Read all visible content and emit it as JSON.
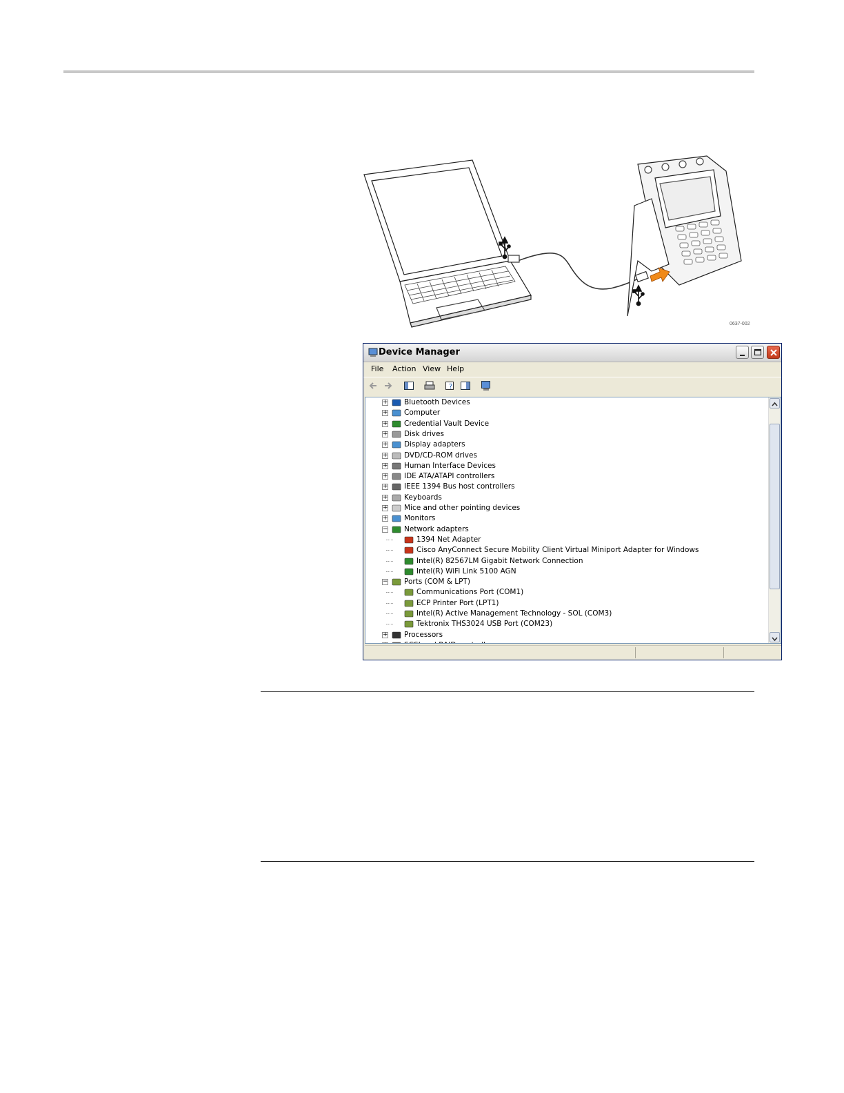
{
  "figure": {
    "id_label": "0637-002",
    "icons": [
      "laptop",
      "usb-icon",
      "usb-cable",
      "oscilloscope",
      "usb-icon"
    ]
  },
  "window": {
    "title": "Device Manager",
    "menu": [
      "File",
      "Action",
      "View",
      "Help"
    ],
    "toolbar_icons": [
      "back-arrow-icon",
      "forward-arrow-icon",
      "show-hide-console-tree-icon",
      "print-icon",
      "help-icon",
      "action-pane-icon",
      "scan-hardware-icon"
    ],
    "tree": [
      {
        "label": "Bluetooth Devices",
        "level": 0,
        "expanded": false,
        "icon": "bluetooth-icon"
      },
      {
        "label": "Computer",
        "level": 0,
        "expanded": false,
        "icon": "computer-icon"
      },
      {
        "label": "Credential Vault Device",
        "level": 0,
        "expanded": false,
        "icon": "board-icon"
      },
      {
        "label": "Disk drives",
        "level": 0,
        "expanded": false,
        "icon": "disk-icon"
      },
      {
        "label": "Display adapters",
        "level": 0,
        "expanded": false,
        "icon": "display-icon"
      },
      {
        "label": "DVD/CD-ROM drives",
        "level": 0,
        "expanded": false,
        "icon": "cd-icon"
      },
      {
        "label": "Human Interface Devices",
        "level": 0,
        "expanded": false,
        "icon": "hid-icon"
      },
      {
        "label": "IDE ATA/ATAPI controllers",
        "level": 0,
        "expanded": false,
        "icon": "ide-icon"
      },
      {
        "label": "IEEE 1394 Bus host controllers",
        "level": 0,
        "expanded": false,
        "icon": "ieee1394-icon"
      },
      {
        "label": "Keyboards",
        "level": 0,
        "expanded": false,
        "icon": "keyboard-icon"
      },
      {
        "label": "Mice and other pointing devices",
        "level": 0,
        "expanded": false,
        "icon": "mouse-icon"
      },
      {
        "label": "Monitors",
        "level": 0,
        "expanded": false,
        "icon": "monitor-icon"
      },
      {
        "label": "Network adapters",
        "level": 0,
        "expanded": true,
        "icon": "network-icon"
      },
      {
        "label": "1394 Net Adapter",
        "level": 1,
        "icon": "network-red-icon"
      },
      {
        "label": "Cisco AnyConnect Secure Mobility Client Virtual Miniport Adapter for Windows",
        "level": 1,
        "icon": "network-red-icon"
      },
      {
        "label": "Intel(R) 82567LM Gigabit Network Connection",
        "level": 1,
        "icon": "network-icon"
      },
      {
        "label": "Intel(R) WiFi Link 5100 AGN",
        "level": 1,
        "icon": "network-icon"
      },
      {
        "label": "Ports (COM & LPT)",
        "level": 0,
        "expanded": true,
        "icon": "port-icon"
      },
      {
        "label": "Communications Port (COM1)",
        "level": 1,
        "icon": "port-icon"
      },
      {
        "label": "ECP Printer Port (LPT1)",
        "level": 1,
        "icon": "port-icon"
      },
      {
        "label": "Intel(R) Active Management Technology - SOL (COM3)",
        "level": 1,
        "icon": "port-icon"
      },
      {
        "label": "Tektronix THS3024 USB Port (COM23)",
        "level": 1,
        "icon": "port-icon"
      },
      {
        "label": "Processors",
        "level": 0,
        "expanded": false,
        "icon": "processor-icon"
      },
      {
        "label": "SCSI and RAID controllers",
        "level": 0,
        "expanded": false,
        "icon": "scsi-icon"
      }
    ]
  }
}
